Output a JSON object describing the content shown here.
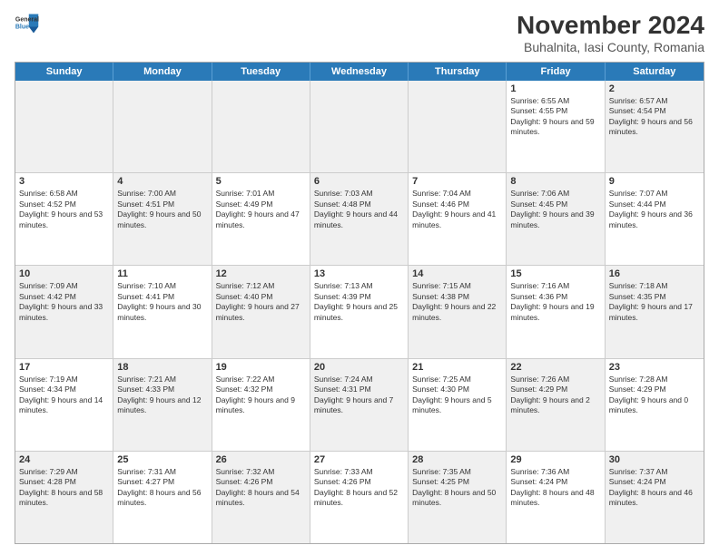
{
  "logo": {
    "line1": "General",
    "line2": "Blue"
  },
  "title": "November 2024",
  "subtitle": "Buhalnita, Iasi County, Romania",
  "days": [
    "Sunday",
    "Monday",
    "Tuesday",
    "Wednesday",
    "Thursday",
    "Friday",
    "Saturday"
  ],
  "rows": [
    [
      {
        "day": "",
        "info": "",
        "shaded": true
      },
      {
        "day": "",
        "info": "",
        "shaded": true
      },
      {
        "day": "",
        "info": "",
        "shaded": true
      },
      {
        "day": "",
        "info": "",
        "shaded": true
      },
      {
        "day": "",
        "info": "",
        "shaded": true
      },
      {
        "day": "1",
        "info": "Sunrise: 6:55 AM\nSunset: 4:55 PM\nDaylight: 9 hours and 59 minutes.",
        "shaded": false
      },
      {
        "day": "2",
        "info": "Sunrise: 6:57 AM\nSunset: 4:54 PM\nDaylight: 9 hours and 56 minutes.",
        "shaded": true
      }
    ],
    [
      {
        "day": "3",
        "info": "Sunrise: 6:58 AM\nSunset: 4:52 PM\nDaylight: 9 hours and 53 minutes.",
        "shaded": false
      },
      {
        "day": "4",
        "info": "Sunrise: 7:00 AM\nSunset: 4:51 PM\nDaylight: 9 hours and 50 minutes.",
        "shaded": true
      },
      {
        "day": "5",
        "info": "Sunrise: 7:01 AM\nSunset: 4:49 PM\nDaylight: 9 hours and 47 minutes.",
        "shaded": false
      },
      {
        "day": "6",
        "info": "Sunrise: 7:03 AM\nSunset: 4:48 PM\nDaylight: 9 hours and 44 minutes.",
        "shaded": true
      },
      {
        "day": "7",
        "info": "Sunrise: 7:04 AM\nSunset: 4:46 PM\nDaylight: 9 hours and 41 minutes.",
        "shaded": false
      },
      {
        "day": "8",
        "info": "Sunrise: 7:06 AM\nSunset: 4:45 PM\nDaylight: 9 hours and 39 minutes.",
        "shaded": true
      },
      {
        "day": "9",
        "info": "Sunrise: 7:07 AM\nSunset: 4:44 PM\nDaylight: 9 hours and 36 minutes.",
        "shaded": false
      }
    ],
    [
      {
        "day": "10",
        "info": "Sunrise: 7:09 AM\nSunset: 4:42 PM\nDaylight: 9 hours and 33 minutes.",
        "shaded": true
      },
      {
        "day": "11",
        "info": "Sunrise: 7:10 AM\nSunset: 4:41 PM\nDaylight: 9 hours and 30 minutes.",
        "shaded": false
      },
      {
        "day": "12",
        "info": "Sunrise: 7:12 AM\nSunset: 4:40 PM\nDaylight: 9 hours and 27 minutes.",
        "shaded": true
      },
      {
        "day": "13",
        "info": "Sunrise: 7:13 AM\nSunset: 4:39 PM\nDaylight: 9 hours and 25 minutes.",
        "shaded": false
      },
      {
        "day": "14",
        "info": "Sunrise: 7:15 AM\nSunset: 4:38 PM\nDaylight: 9 hours and 22 minutes.",
        "shaded": true
      },
      {
        "day": "15",
        "info": "Sunrise: 7:16 AM\nSunset: 4:36 PM\nDaylight: 9 hours and 19 minutes.",
        "shaded": false
      },
      {
        "day": "16",
        "info": "Sunrise: 7:18 AM\nSunset: 4:35 PM\nDaylight: 9 hours and 17 minutes.",
        "shaded": true
      }
    ],
    [
      {
        "day": "17",
        "info": "Sunrise: 7:19 AM\nSunset: 4:34 PM\nDaylight: 9 hours and 14 minutes.",
        "shaded": false
      },
      {
        "day": "18",
        "info": "Sunrise: 7:21 AM\nSunset: 4:33 PM\nDaylight: 9 hours and 12 minutes.",
        "shaded": true
      },
      {
        "day": "19",
        "info": "Sunrise: 7:22 AM\nSunset: 4:32 PM\nDaylight: 9 hours and 9 minutes.",
        "shaded": false
      },
      {
        "day": "20",
        "info": "Sunrise: 7:24 AM\nSunset: 4:31 PM\nDaylight: 9 hours and 7 minutes.",
        "shaded": true
      },
      {
        "day": "21",
        "info": "Sunrise: 7:25 AM\nSunset: 4:30 PM\nDaylight: 9 hours and 5 minutes.",
        "shaded": false
      },
      {
        "day": "22",
        "info": "Sunrise: 7:26 AM\nSunset: 4:29 PM\nDaylight: 9 hours and 2 minutes.",
        "shaded": true
      },
      {
        "day": "23",
        "info": "Sunrise: 7:28 AM\nSunset: 4:29 PM\nDaylight: 9 hours and 0 minutes.",
        "shaded": false
      }
    ],
    [
      {
        "day": "24",
        "info": "Sunrise: 7:29 AM\nSunset: 4:28 PM\nDaylight: 8 hours and 58 minutes.",
        "shaded": true
      },
      {
        "day": "25",
        "info": "Sunrise: 7:31 AM\nSunset: 4:27 PM\nDaylight: 8 hours and 56 minutes.",
        "shaded": false
      },
      {
        "day": "26",
        "info": "Sunrise: 7:32 AM\nSunset: 4:26 PM\nDaylight: 8 hours and 54 minutes.",
        "shaded": true
      },
      {
        "day": "27",
        "info": "Sunrise: 7:33 AM\nSunset: 4:26 PM\nDaylight: 8 hours and 52 minutes.",
        "shaded": false
      },
      {
        "day": "28",
        "info": "Sunrise: 7:35 AM\nSunset: 4:25 PM\nDaylight: 8 hours and 50 minutes.",
        "shaded": true
      },
      {
        "day": "29",
        "info": "Sunrise: 7:36 AM\nSunset: 4:24 PM\nDaylight: 8 hours and 48 minutes.",
        "shaded": false
      },
      {
        "day": "30",
        "info": "Sunrise: 7:37 AM\nSunset: 4:24 PM\nDaylight: 8 hours and 46 minutes.",
        "shaded": true
      }
    ]
  ]
}
